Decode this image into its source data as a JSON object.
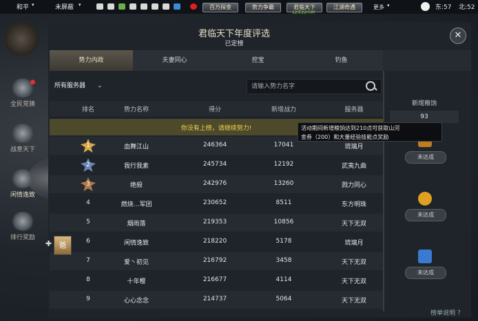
{
  "topbar": {
    "mode": "和平",
    "shield": "未屏蔽",
    "buttons": [
      "百万探金",
      "势力争霸",
      "君临天下",
      "江湖奇遇"
    ],
    "sub_badge": "12天22小时",
    "more": "更多",
    "zone": "东:57",
    "time": "北:52"
  },
  "window": {
    "title": "君临天下年度评选",
    "subtitle": "已定榜",
    "close": "✕"
  },
  "left_nav": [
    {
      "label": "全民竞猜"
    },
    {
      "label": "战意天下"
    },
    {
      "label": "闲情逸致"
    },
    {
      "label": "排行奖励"
    }
  ],
  "tabs": [
    "势力内政",
    "夫妻同心",
    "挖宝",
    "钓鱼"
  ],
  "filter": {
    "server": "所有服务器",
    "search_placeholder": "请输入势力名字"
  },
  "table": {
    "headers": [
      "排名",
      "势力名称",
      "得分",
      "新增战力",
      "服务器"
    ],
    "notice": "你没有上榜，请继续努力!",
    "rows": [
      {
        "rank": "1",
        "name": "血舞江山",
        "score": "246364",
        "power": "17041",
        "server": "琉璃月"
      },
      {
        "rank": "2",
        "name": "我行我素",
        "score": "245734",
        "power": "12192",
        "server": "武夷九曲"
      },
      {
        "rank": "3",
        "name": "绝殺",
        "score": "242976",
        "power": "13260",
        "server": "戮力同心"
      },
      {
        "rank": "4",
        "name": "燃烧…军团",
        "score": "230652",
        "power": "8511",
        "server": "东方明珠"
      },
      {
        "rank": "5",
        "name": "烟雨落",
        "score": "219353",
        "power": "10856",
        "server": "天下无双"
      },
      {
        "rank": "6",
        "name": "闲情逸致",
        "score": "218220",
        "power": "5178",
        "server": "琉璃月"
      },
      {
        "rank": "7",
        "name": "爱丶初见",
        "score": "216792",
        "power": "3458",
        "server": "天下无双"
      },
      {
        "rank": "8",
        "name": "十年樱",
        "score": "216677",
        "power": "4114",
        "server": "天下无双"
      },
      {
        "rank": "9",
        "name": "心心念念",
        "score": "214737",
        "power": "5064",
        "server": "天下无双"
      }
    ]
  },
  "rewards": {
    "header": "新增粮饷",
    "value": "93",
    "tooltip_line1": "活动期间新增粮饷达到210点可获取山河",
    "tooltip_line2": "金券（200）和大量经验技能点奖励",
    "items": [
      {
        "icon": "gift-icon",
        "status": "未达成",
        "color": "#c07a20"
      },
      {
        "icon": "gold-ingot-icon",
        "status": "未达成",
        "color": "#e0a020"
      },
      {
        "icon": "crystal-icon",
        "status": "未达成",
        "color": "#3a7ad0"
      }
    ]
  },
  "hover_avatar": "爸",
  "help": "榜单说明 ？"
}
